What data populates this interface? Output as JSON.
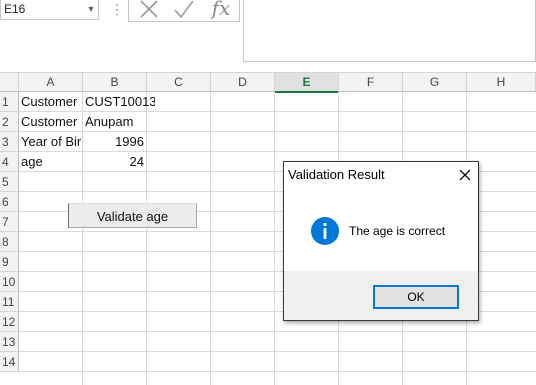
{
  "formula_bar": {
    "name_box": "E16",
    "dots": "⋮",
    "fx": "fx",
    "formula": ""
  },
  "columns": [
    "A",
    "B",
    "C",
    "D",
    "E",
    "F",
    "G",
    "H"
  ],
  "active_column": "E",
  "rows": [
    "1",
    "2",
    "3",
    "4",
    "5",
    "6",
    "7",
    "8",
    "9",
    "10",
    "11",
    "12",
    "13",
    "14"
  ],
  "cells": {
    "A1": "Customer",
    "B1": "CUST10013",
    "A2": "Customer",
    "B2": "Anupam",
    "A3": "Year of Bir",
    "B3": "1996",
    "A4": "age",
    "B4": "24"
  },
  "validate_button": {
    "label": "Validate age"
  },
  "dialog": {
    "title": "Validation Result",
    "message": "The age is correct",
    "icon": "info-icon",
    "ok_label": "OK",
    "accent": "#0078d7"
  },
  "colors": {
    "active_header": "#217346",
    "info_icon": "#0078d7"
  }
}
